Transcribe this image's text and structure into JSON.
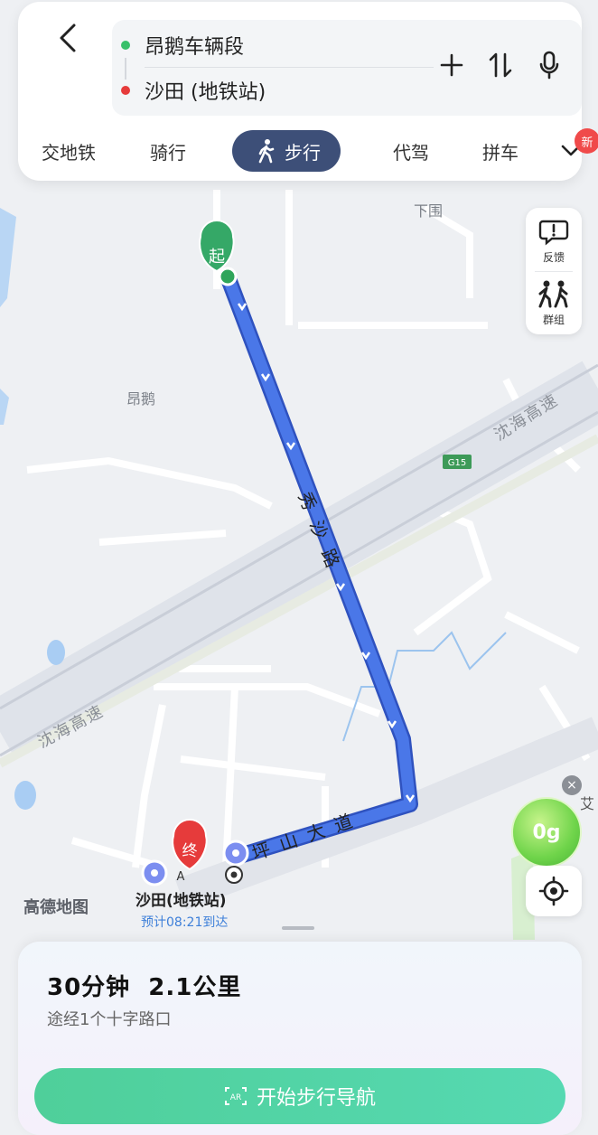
{
  "header": {
    "origin": "昂鹅车辆段",
    "destination": "沙田 (地铁站)",
    "colors": {
      "origin_dot": "#39c06a",
      "destination_dot": "#e63b3b"
    }
  },
  "tabs": {
    "items": [
      "交地铁",
      "骑行",
      "步行",
      "代驾",
      "拼车"
    ],
    "active": "步行",
    "new_badge": "新"
  },
  "side_tools": {
    "feedback": "反馈",
    "group": "群组"
  },
  "map": {
    "labels": {
      "xiawei": "下围",
      "angang": "昂鹅",
      "expressway": "沈海高速",
      "g15": "G15",
      "road_xiusha": "秀沙路",
      "road_pingshan": "坪山大道",
      "partial_right": "艾"
    },
    "start_marker": "起",
    "end_marker": "终",
    "point_a": "A",
    "destination_name": "沙田(地铁站)",
    "arrival_hint": "预计08:21到达",
    "logo": "高德地图",
    "carbon": "0g"
  },
  "summary": {
    "duration_distance": "30分钟  2.1公里",
    "via": "途经1个十字路口",
    "start_button": "开始步行导航",
    "ar_label": "AR"
  },
  "colors": {
    "route": "#4a77e8",
    "button": "#52d3a4",
    "tab_active": "#3d4f78"
  }
}
